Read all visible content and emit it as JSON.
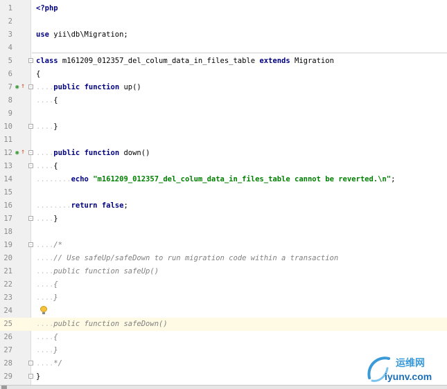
{
  "editor": {
    "gutter_marks": [
      {
        "line": 7,
        "icons": [
          "override-method-icon",
          "arrow-up-icon"
        ]
      },
      {
        "line": 12,
        "icons": [
          "override-method-icon",
          "arrow-up-icon"
        ]
      }
    ],
    "current_line": 25,
    "lines": [
      {
        "n": "1",
        "tokens": [
          {
            "t": "<?php",
            "c": "kw"
          }
        ]
      },
      {
        "n": "2",
        "tokens": []
      },
      {
        "n": "3",
        "tokens": [
          {
            "t": "use",
            "c": "kw"
          },
          {
            "t": " yii\\db\\Migration;",
            "c": ""
          }
        ]
      },
      {
        "n": "4",
        "tokens": []
      },
      {
        "n": "5",
        "tokens": [
          {
            "t": "class",
            "c": "kw"
          },
          {
            "t": " m161209_012357_del_colum_data_in_files_table ",
            "c": ""
          },
          {
            "t": "extends",
            "c": "kw"
          },
          {
            "t": " Migration",
            "c": ""
          }
        ]
      },
      {
        "n": "6",
        "tokens": [
          {
            "t": "{",
            "c": ""
          }
        ]
      },
      {
        "n": "7",
        "tokens": [
          {
            "t": "....",
            "c": "dots"
          },
          {
            "t": "public",
            "c": "kw"
          },
          {
            "t": " ",
            "c": ""
          },
          {
            "t": "function",
            "c": "kw"
          },
          {
            "t": " up()",
            "c": ""
          }
        ]
      },
      {
        "n": "8",
        "tokens": [
          {
            "t": "....",
            "c": "dots"
          },
          {
            "t": "{",
            "c": ""
          }
        ]
      },
      {
        "n": "9",
        "tokens": []
      },
      {
        "n": "10",
        "tokens": [
          {
            "t": "....",
            "c": "dots"
          },
          {
            "t": "}",
            "c": ""
          }
        ]
      },
      {
        "n": "11",
        "tokens": []
      },
      {
        "n": "12",
        "tokens": [
          {
            "t": "....",
            "c": "dots"
          },
          {
            "t": "public",
            "c": "kw"
          },
          {
            "t": " ",
            "c": ""
          },
          {
            "t": "function",
            "c": "kw"
          },
          {
            "t": " down()",
            "c": ""
          }
        ]
      },
      {
        "n": "13",
        "tokens": [
          {
            "t": "....",
            "c": "dots"
          },
          {
            "t": "{",
            "c": ""
          }
        ]
      },
      {
        "n": "14",
        "tokens": [
          {
            "t": "........",
            "c": "dots"
          },
          {
            "t": "echo",
            "c": "kw"
          },
          {
            "t": " ",
            "c": ""
          },
          {
            "t": "\"m161209_012357_del_colum_data_in_files_table cannot be reverted.\\n\"",
            "c": "str"
          },
          {
            "t": ";",
            "c": ""
          }
        ]
      },
      {
        "n": "15",
        "tokens": []
      },
      {
        "n": "16",
        "tokens": [
          {
            "t": "........",
            "c": "dots"
          },
          {
            "t": "return",
            "c": "kw"
          },
          {
            "t": " ",
            "c": ""
          },
          {
            "t": "false",
            "c": "kw"
          },
          {
            "t": ";",
            "c": ""
          }
        ]
      },
      {
        "n": "17",
        "tokens": [
          {
            "t": "....",
            "c": "dots"
          },
          {
            "t": "}",
            "c": ""
          }
        ]
      },
      {
        "n": "18",
        "tokens": []
      },
      {
        "n": "19",
        "tokens": [
          {
            "t": "....",
            "c": "dots"
          },
          {
            "t": "/*",
            "c": "cm"
          }
        ]
      },
      {
        "n": "20",
        "tokens": [
          {
            "t": "....",
            "c": "dots"
          },
          {
            "t": "// Use safeUp/safeDown to run migration code within a transaction",
            "c": "cm"
          }
        ]
      },
      {
        "n": "21",
        "tokens": [
          {
            "t": "....",
            "c": "dots"
          },
          {
            "t": "public function safeUp()",
            "c": "cm"
          }
        ]
      },
      {
        "n": "22",
        "tokens": [
          {
            "t": "....",
            "c": "dots"
          },
          {
            "t": "{",
            "c": "cm"
          }
        ]
      },
      {
        "n": "23",
        "tokens": [
          {
            "t": "....",
            "c": "dots"
          },
          {
            "t": "}",
            "c": "cm"
          }
        ]
      },
      {
        "n": "24",
        "tokens": []
      },
      {
        "n": "25",
        "tokens": [
          {
            "t": "....",
            "c": "dots"
          },
          {
            "t": "public function safeDown()",
            "c": "cm"
          }
        ]
      },
      {
        "n": "26",
        "tokens": [
          {
            "t": "....",
            "c": "dots"
          },
          {
            "t": "{",
            "c": "cm"
          }
        ]
      },
      {
        "n": "27",
        "tokens": [
          {
            "t": "....",
            "c": "dots"
          },
          {
            "t": "}",
            "c": "cm"
          }
        ]
      },
      {
        "n": "28",
        "tokens": [
          {
            "t": "....",
            "c": "dots"
          },
          {
            "t": "*/",
            "c": "cm"
          }
        ]
      },
      {
        "n": "29",
        "tokens": [
          {
            "t": "}",
            "c": ""
          }
        ]
      }
    ],
    "fold_lines": [
      "5",
      "7",
      "10",
      "12",
      "13",
      "17",
      "19",
      "28",
      "29"
    ]
  },
  "intention": {
    "icon": "lightbulb-icon",
    "line": 24
  },
  "watermark": {
    "chinese": "运维网",
    "url": "iyunv.com"
  },
  "colors": {
    "keyword": "#000080",
    "string": "#008000",
    "comment": "#808080",
    "current_line": "#fffae3"
  }
}
